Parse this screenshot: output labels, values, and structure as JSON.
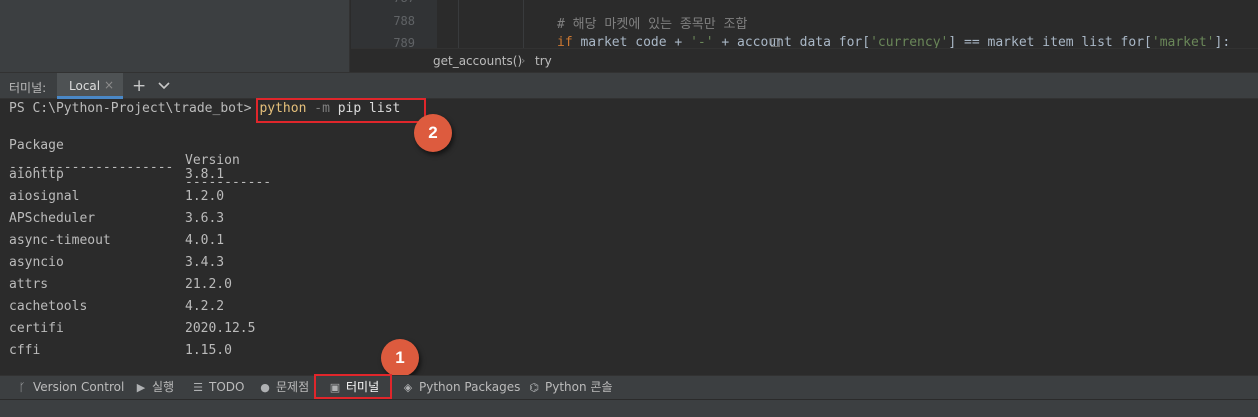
{
  "editor": {
    "gutter_lines": [
      "787",
      "788",
      "789"
    ],
    "code": {
      "comment": "# 해당 마켓에 있는 종목만 조합",
      "line2_kw": "if",
      "line2_a": " market_code + ",
      "line2_s1": "'-'",
      "line2_b": " + account_data_for[",
      "line2_s2": "'currency'",
      "line2_c": "] == market_item_list_for[",
      "line2_s3": "'market'",
      "line2_d": "]:"
    },
    "breadcrumb": [
      "get_accounts()",
      "try"
    ]
  },
  "terminal_header": {
    "title": "터미널:",
    "tab_label": "Local",
    "close_glyph": "×",
    "plus_glyph": "+"
  },
  "terminal": {
    "prompt": "PS C:\\Python-Project\\trade_bot> ",
    "cmd_python": "python",
    "cmd_flag": "-m",
    "cmd_rest": "pip list",
    "header": {
      "name": "Package",
      "version": "Version"
    },
    "divider": {
      "name": "---------------------",
      "version": "-----------"
    },
    "packages": [
      {
        "name": "aiohttp",
        "version": "3.8.1"
      },
      {
        "name": "aiosignal",
        "version": "1.2.0"
      },
      {
        "name": "APScheduler",
        "version": "3.6.3"
      },
      {
        "name": "async-timeout",
        "version": "4.0.1"
      },
      {
        "name": "asyncio",
        "version": "3.4.3"
      },
      {
        "name": "attrs",
        "version": "21.2.0"
      },
      {
        "name": "cachetools",
        "version": "4.2.2"
      },
      {
        "name": "certifi",
        "version": "2020.12.5"
      },
      {
        "name": "cffi",
        "version": "1.15.0"
      }
    ]
  },
  "annotations": {
    "badge_1": "1",
    "badge_2": "2",
    "highlight_color": "#e0262b",
    "badge_color": "#dd5b3e"
  },
  "toolbar": {
    "items": [
      {
        "label": "Version Control",
        "icon": "branch-icon"
      },
      {
        "label": "실행",
        "icon": "run-icon"
      },
      {
        "label": "TODO",
        "icon": "todo-list-icon"
      },
      {
        "label": "문제점",
        "icon": "problems-icon"
      },
      {
        "label": "터미널",
        "icon": "terminal-icon"
      },
      {
        "label": "Python Packages",
        "icon": "layers-icon"
      },
      {
        "label": "Python 콘솔",
        "icon": "python-icon"
      }
    ]
  },
  "colors": {
    "background": "#2b2b2b",
    "panel": "#3c3f41",
    "tab_underline": "#4a88c7"
  }
}
